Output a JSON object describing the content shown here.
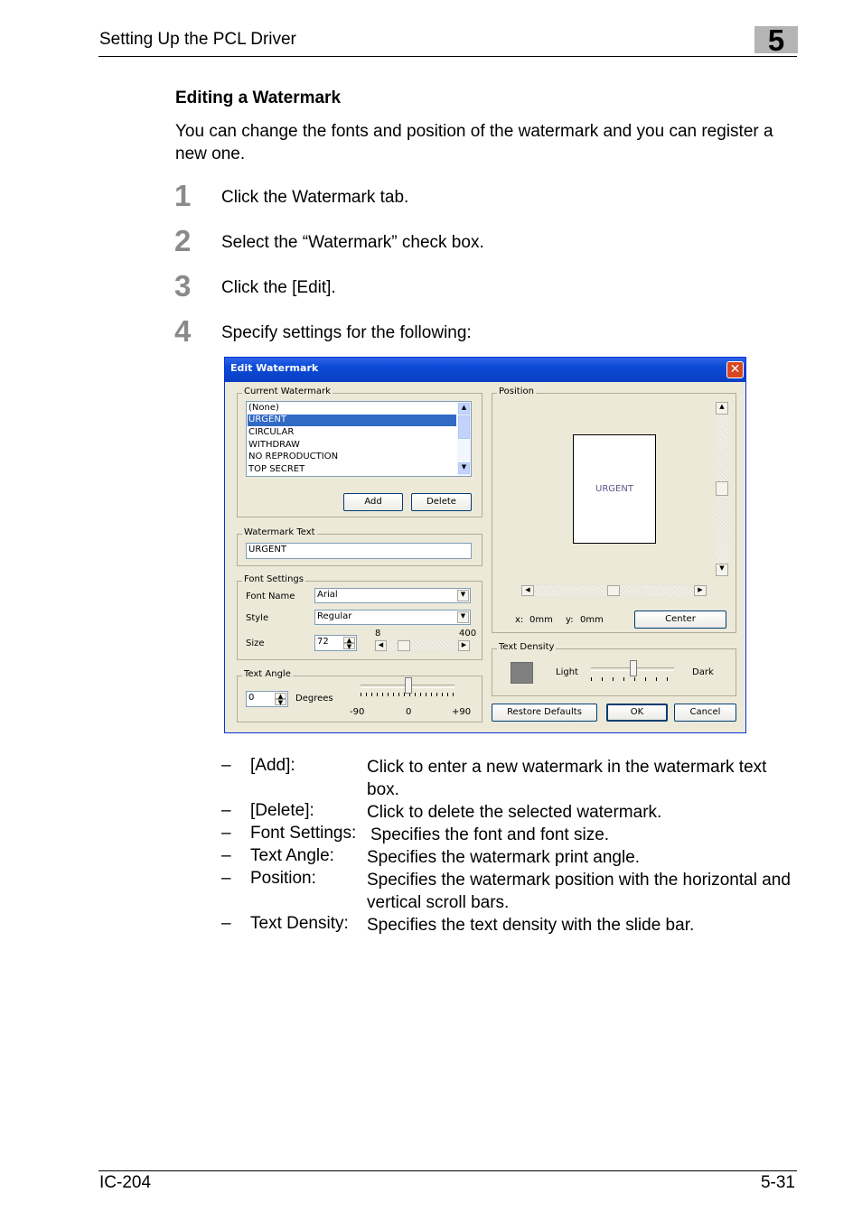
{
  "header": {
    "title": "Setting Up the PCL Driver",
    "chapter": "5"
  },
  "section": {
    "title": "Editing a Watermark",
    "intro": "You can change the fonts and position of the watermark and you can register a new one."
  },
  "steps": [
    {
      "num": "1",
      "text": "Click the Watermark tab."
    },
    {
      "num": "2",
      "text": "Select the “Watermark” check box."
    },
    {
      "num": "3",
      "text": "Click the [Edit]."
    },
    {
      "num": "4",
      "text": "Specify settings for the following:"
    }
  ],
  "dialog": {
    "title": "Edit Watermark",
    "close_glyph": "✕",
    "current_watermark": {
      "label": "Current Watermark",
      "items": [
        "(None)",
        "URGENT",
        "CIRCULAR",
        "WITHDRAW",
        "NO REPRODUCTION",
        "TOP SECRET"
      ],
      "selected": "URGENT",
      "add": "Add",
      "delete": "Delete"
    },
    "watermark_text": {
      "label": "Watermark Text",
      "value": "URGENT"
    },
    "font_settings": {
      "label": "Font Settings",
      "font_name_label": "Font Name",
      "font_name": "Arial",
      "style_label": "Style",
      "style": "Regular",
      "size_label": "Size",
      "size": "72",
      "size_min": "8",
      "size_max": "400"
    },
    "text_angle": {
      "label": "Text Angle",
      "value": "0",
      "unit": "Degrees",
      "min": "-90",
      "mid": "0",
      "max": "+90"
    },
    "position": {
      "label": "Position",
      "preview_text": "URGENT",
      "x_label": "x:",
      "x_value": "0mm",
      "y_label": "y:",
      "y_value": "0mm",
      "center": "Center"
    },
    "text_density": {
      "label": "Text Density",
      "light": "Light",
      "dark": "Dark",
      "swatch_color": "#808080"
    },
    "buttons": {
      "restore": "Restore Defaults",
      "ok": "OK",
      "cancel": "Cancel"
    },
    "colors": {
      "titlebar": "#0b4ad6",
      "selection": "#316ac5"
    }
  },
  "bullets": [
    {
      "dash": "–",
      "term": "[Add]:",
      "desc": "Click to enter a new watermark in the watermark text box."
    },
    {
      "dash": "–",
      "term": "[Delete]:",
      "desc": "Click to delete the selected watermark."
    },
    {
      "dash": "–",
      "term": "Font Settings:",
      "desc": "Specifies the font and font size."
    },
    {
      "dash": "–",
      "term": "Text Angle:",
      "desc": "Specifies the watermark print angle."
    },
    {
      "dash": "–",
      "term": "Position:",
      "desc": "Specifies the watermark position with the horizontal and vertical scroll bars."
    },
    {
      "dash": "–",
      "term": "Text Density:",
      "desc": "Specifies the text density with the slide bar."
    }
  ],
  "footer": {
    "left": "IC-204",
    "right": "5-31"
  }
}
